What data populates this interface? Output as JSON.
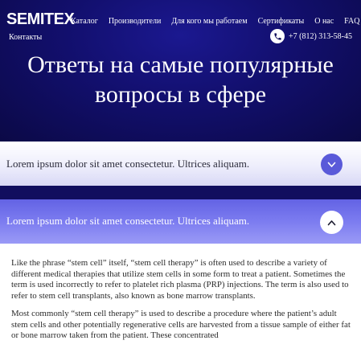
{
  "header": {
    "logo": "SEMITEX",
    "nav": [
      "Каталог",
      "Производители",
      "Для кого мы работаем",
      "Сертификаты",
      "О нас",
      "FAQ"
    ],
    "nav_second_row": "Контакты",
    "phone": "+7 (812) 313-58-45",
    "phone_icon": "phone-icon"
  },
  "hero": {
    "title_line1": "Ответы на самые популярные",
    "title_line2": "вопросы в сфере"
  },
  "faq": {
    "items": [
      {
        "question": "Lorem ipsum dolor sit amet consectetur. Ultrices aliquam.",
        "state": "collapsed",
        "toggle_symbol": "v"
      },
      {
        "question": "Lorem ipsum dolor sit amet consectetur. Ultrices aliquam.",
        "state": "expanded",
        "toggle_symbol": "^"
      }
    ],
    "answer_paragraphs": [
      "Like the phrase “stem cell” itself, “stem cell therapy” is often used to describe a variety of different medical therapies that utilize stem cells in some form to treat a patient. Sometimes the term is used incorrectly to refer to platelet rich plasma (PRP) injections. The term is also used to refer to stem cell transplants, also known as bone marrow transplants.",
      "Most commonly “stem cell therapy” is used to describe a procedure where the patient’s adult stem cells and other potentially regenerative cells are harvested from a tissue sample of either fat or bone marrow taken from the patient. These concentrated"
    ]
  },
  "colors": {
    "hero_dark": "#0b0946",
    "hero_mid": "#1b1890",
    "accent": "#5a5ad9",
    "expanded_panel": "#7c7cf0"
  }
}
